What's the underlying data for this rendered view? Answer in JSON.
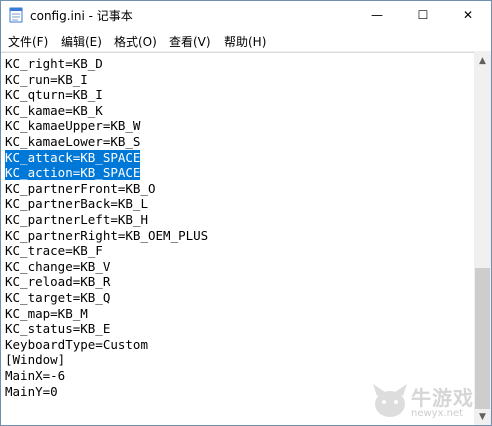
{
  "window": {
    "title": "config.ini - 记事本"
  },
  "controls": {
    "minimize": "—",
    "maximize": "☐",
    "close": "✕"
  },
  "menu": [
    {
      "label": "文件(F)"
    },
    {
      "label": "编辑(E)"
    },
    {
      "label": "格式(O)"
    },
    {
      "label": "查看(V)"
    },
    {
      "label": "帮助(H)"
    }
  ],
  "editor": {
    "lines": [
      "KC_right=KB_D",
      "KC_run=KB_I",
      "KC_qturn=KB_I",
      "KC_kamae=KB_K",
      "KC_kamaeUpper=KB_W",
      "KC_kamaeLower=KB_S",
      "KC_attack=KB_SPACE",
      "KC_action=KB_SPACE",
      "KC_partnerFront=KB_O",
      "KC_partnerBack=KB_L",
      "KC_partnerLeft=KB_H",
      "KC_partnerRight=KB_OEM_PLUS",
      "KC_trace=KB_F",
      "KC_change=KB_V",
      "KC_reload=KB_R",
      "KC_target=KB_Q",
      "KC_map=KB_M",
      "KC_status=KB_E",
      "KeyboardType=Custom",
      "[Window]",
      "MainX=-6",
      "MainY=0"
    ],
    "selected_lines": [
      6,
      7
    ]
  },
  "watermark": {
    "brand": "牛游戏",
    "site": "newyx.net"
  }
}
